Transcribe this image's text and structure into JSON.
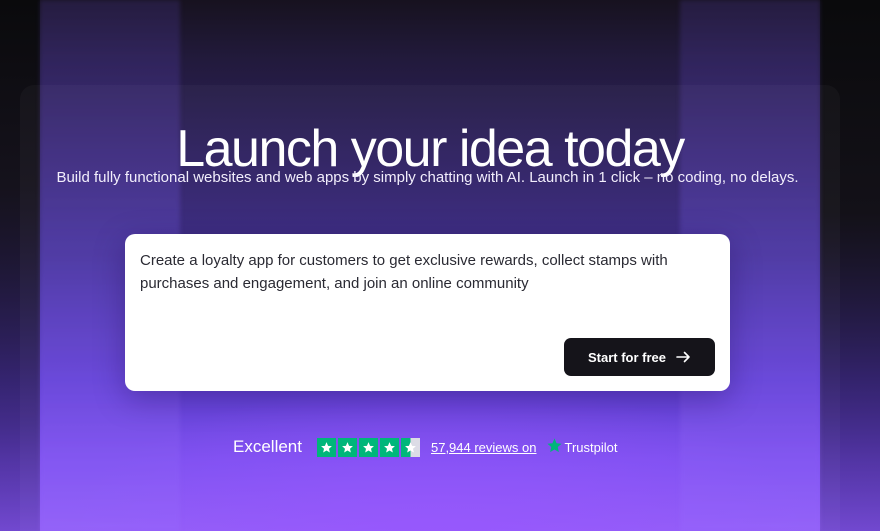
{
  "hero": {
    "headline": "Launch your idea today",
    "subtitle": "Build fully functional websites and web apps by simply chatting with AI. Launch in 1 click – no coding, no delays."
  },
  "prompt": {
    "text": "Create a loyalty app for customers to get exclusive rewards, collect stamps with purchases and engagement, and join an online community",
    "button_label": "Start for free",
    "button_icon": "arrow-right-icon"
  },
  "rating": {
    "label": "Excellent",
    "stars": 4.5,
    "reviews_text": "57,944 reviews on",
    "brand": "Trustpilot",
    "star_color": "#00b67a"
  },
  "colors": {
    "accent": "#7a4cf0",
    "button_bg": "#15141a"
  }
}
